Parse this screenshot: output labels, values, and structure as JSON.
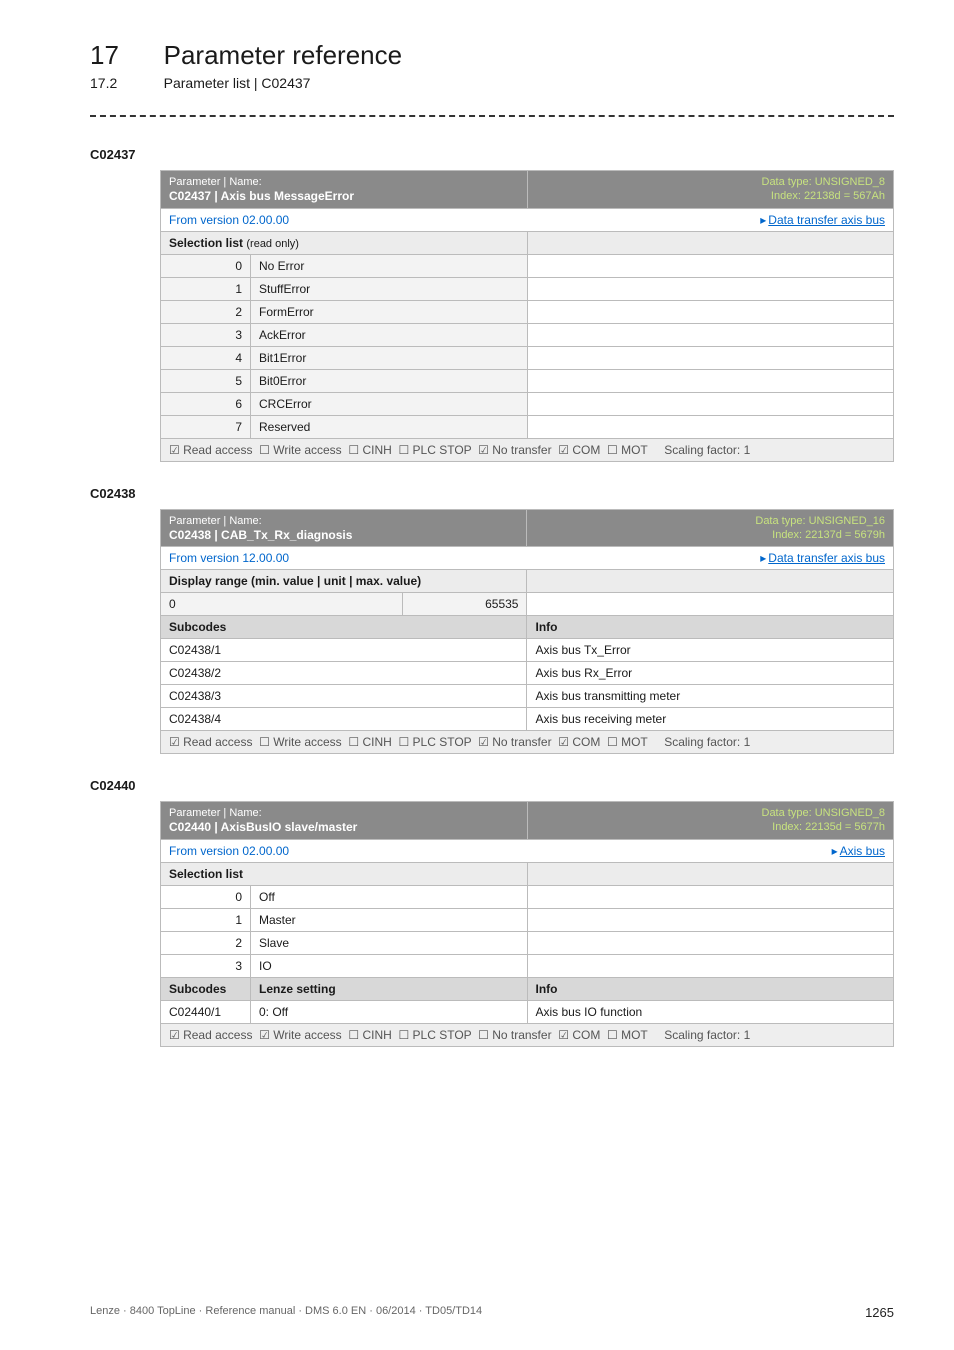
{
  "chapter": {
    "num": "17",
    "title": "Parameter reference"
  },
  "sub": {
    "num": "17.2",
    "title": "Parameter list | C02437"
  },
  "common": {
    "param_label": "Parameter | Name:",
    "read_only": "(read only)",
    "subcodes": "Subcodes",
    "info": "Info",
    "lenze_setting": "Lenze setting",
    "selection_list": "Selection list",
    "display_range": "Display range (min. value | unit | max. value)",
    "from_version_02": "From version 02.00.00",
    "from_version_12": "From version 12.00.00",
    "data_transfer_axis_bus": "Data transfer axis bus",
    "axis_bus": "Axis bus",
    "scaling_factor": "Scaling factor: 1",
    "tri": "▸"
  },
  "c02437": {
    "code": "C02437",
    "title": "C02437 | Axis bus MessageError",
    "data_type": "Data type: UNSIGNED_8",
    "index": "Index: 22138d = 567Ah",
    "rows": [
      {
        "n": "0",
        "v": "No Error"
      },
      {
        "n": "1",
        "v": "StuffError"
      },
      {
        "n": "2",
        "v": "FormError"
      },
      {
        "n": "3",
        "v": "AckError"
      },
      {
        "n": "4",
        "v": "Bit1Error"
      },
      {
        "n": "5",
        "v": "Bit0Error"
      },
      {
        "n": "6",
        "v": "CRCError"
      },
      {
        "n": "7",
        "v": "Reserved"
      }
    ],
    "access": "☑ Read access  ☐ Write access  ☐ CINH  ☐ PLC STOP  ☑ No transfer  ☑ COM  ☐ MOT"
  },
  "c02438": {
    "code": "C02438",
    "title": "C02438 | CAB_Tx_Rx_diagnosis",
    "data_type": "Data type: UNSIGNED_16",
    "index": "Index: 22137d = 5679h",
    "min": "0",
    "max": "65535",
    "subs": [
      {
        "c": "C02438/1",
        "i": "Axis bus Tx_Error"
      },
      {
        "c": "C02438/2",
        "i": "Axis bus Rx_Error"
      },
      {
        "c": "C02438/3",
        "i": "Axis bus transmitting meter"
      },
      {
        "c": "C02438/4",
        "i": "Axis bus receiving meter"
      }
    ],
    "access": "☑ Read access  ☐ Write access  ☐ CINH  ☐ PLC STOP  ☑ No transfer  ☑ COM  ☐ MOT"
  },
  "c02440": {
    "code": "C02440",
    "title": "C02440 | AxisBusIO slave/master",
    "data_type": "Data type: UNSIGNED_8",
    "index": "Index: 22135d = 5677h",
    "rows": [
      {
        "n": "0",
        "v": "Off"
      },
      {
        "n": "1",
        "v": "Master"
      },
      {
        "n": "2",
        "v": "Slave"
      },
      {
        "n": "3",
        "v": "IO"
      }
    ],
    "sub": {
      "c": "C02440/1",
      "l": "0: Off",
      "i": "Axis bus IO function"
    },
    "access": "☑ Read access  ☑ Write access  ☐ CINH  ☐ PLC STOP  ☐ No transfer  ☑ COM  ☐ MOT"
  },
  "footer": {
    "left": "Lenze · 8400 TopLine · Reference manual · DMS 6.0 EN · 06/2014 · TD05/TD14",
    "page": "1265"
  }
}
